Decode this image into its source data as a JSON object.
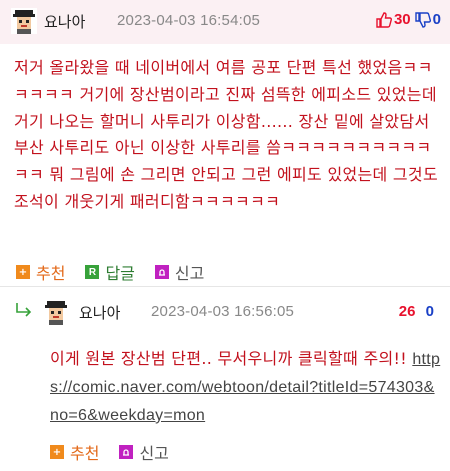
{
  "comment": {
    "nickname": "요나아",
    "date": "2023-04-03 16:54:05",
    "up_votes": "30",
    "down_votes": "0",
    "body": "저거 올라왔을 때 네이버에서 여름 공포 단편 특선 했었음ㅋㅋㅋㅋㅋㅋ 거기에 장산범이라고 진짜 섬뜩한 에피소드 있었는데 거기 나오는 할머니 사투리가 이상함...... 장산 밑에 살았담서 부산 사투리도 아닌 이상한 사투리를 씀ㅋㅋㅋㅋㅋㅋㅋㅋㅋㅋㅋㅋ 뭐 그림에 손 그리면 안되고 그런 에피도 있었는데 그것도 조석이 개웃기게 패러디함ㅋㅋㅋㅋㅋㅋ",
    "actions": {
      "recommend": "추천",
      "reply": "답글",
      "report": "신고"
    }
  },
  "reply": {
    "nickname": "요나아",
    "date": "2023-04-03 16:56:05",
    "up_votes": "26",
    "down_votes": "0",
    "body_text": "이게 원본 장산범 단편.. 무서우니까 클릭할때 주의!! ",
    "link": "https://comic.naver.com/webtoon/detail?titleId=574303&no=6&weekday=mon",
    "actions": {
      "recommend": "추천",
      "report": "신고"
    }
  },
  "colors": {
    "header_bg": "#fbf0f3",
    "body_text": "#c2111d",
    "up_vote": "#e8112d",
    "down_vote": "#1a40c6"
  },
  "icons": [
    "avatar-icon",
    "thumb-up-icon",
    "thumb-down-icon",
    "plus-icon",
    "reply-icon",
    "report-icon",
    "reply-arrow-icon"
  ]
}
